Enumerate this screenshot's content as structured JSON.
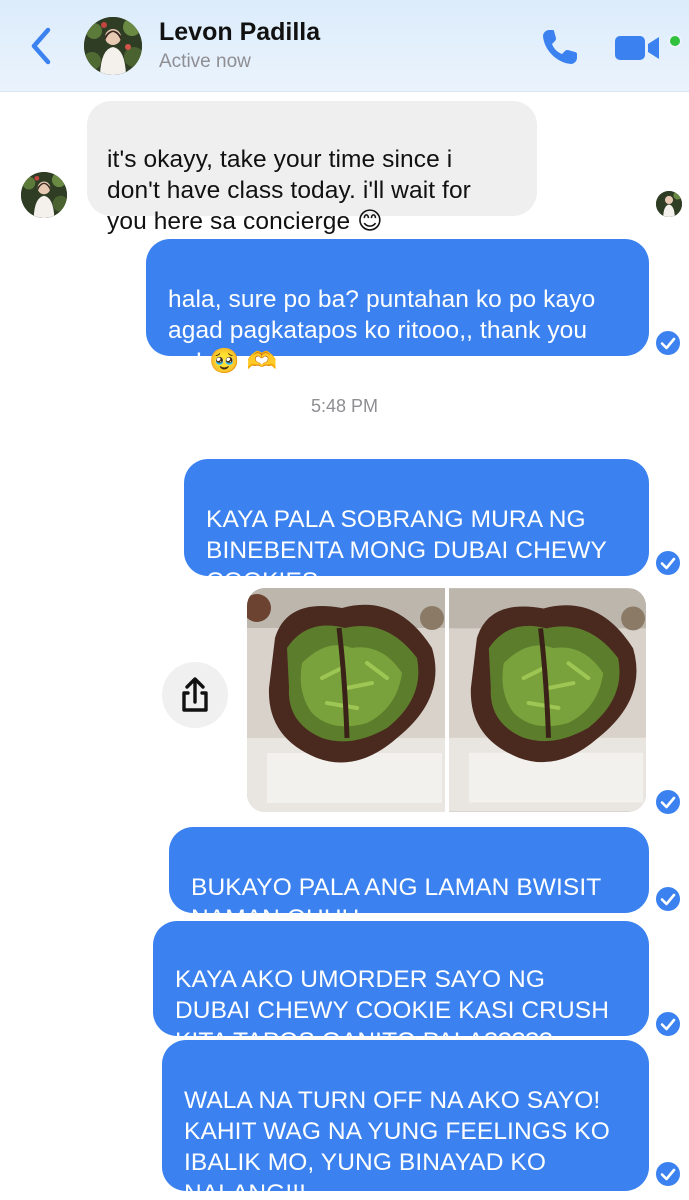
{
  "header": {
    "contact_name": "Levon Padilla",
    "status": "Active now",
    "accent_color": "#3b82f0",
    "online_color": "#31c23d",
    "icons": [
      "chevron-left-icon",
      "phone-icon",
      "video-camera-icon"
    ]
  },
  "messages": [
    {
      "direction": "received",
      "text": "it's okayy, take your time since i\ndon't have class today. i'll wait for\nyou here sa concierge 😊"
    },
    {
      "direction": "sent",
      "text": "hala, sure po ba? puntahan ko po kayo\nagad pagkatapos ko ritooo,, thank you\npo! 🥹 🫶"
    },
    {
      "direction": "timestamp",
      "text": "5:48 PM"
    },
    {
      "direction": "sent",
      "text": "KAYA PALA SOBRANG MURA NG\nBINEBENTA MONG DUBAI CHEWY\nCOOKIES"
    },
    {
      "direction": "sent",
      "type": "photos",
      "count": 2
    },
    {
      "direction": "sent",
      "text": "BUKAYO PALA ANG LAMAN BWISIT\nNAMAN OHHH"
    },
    {
      "direction": "sent",
      "text": "KAYA AKO UMORDER SAYO NG\nDUBAI CHEWY COOKIE KASI CRUSH\nKITA TAPOS GANITO PALA?????"
    },
    {
      "direction": "sent",
      "text": "WALA NA TURN OFF NA AKO SAYO!\nKAHIT WAG NA YUNG FEELINGS KO\nIBALIK MO, YUNG BINAYAD KO\nNALANG!!!"
    }
  ],
  "colors": {
    "sent_bubble": "#3b82f0",
    "received_bubble": "#efefef",
    "timestamp_text": "#8e8e93"
  }
}
